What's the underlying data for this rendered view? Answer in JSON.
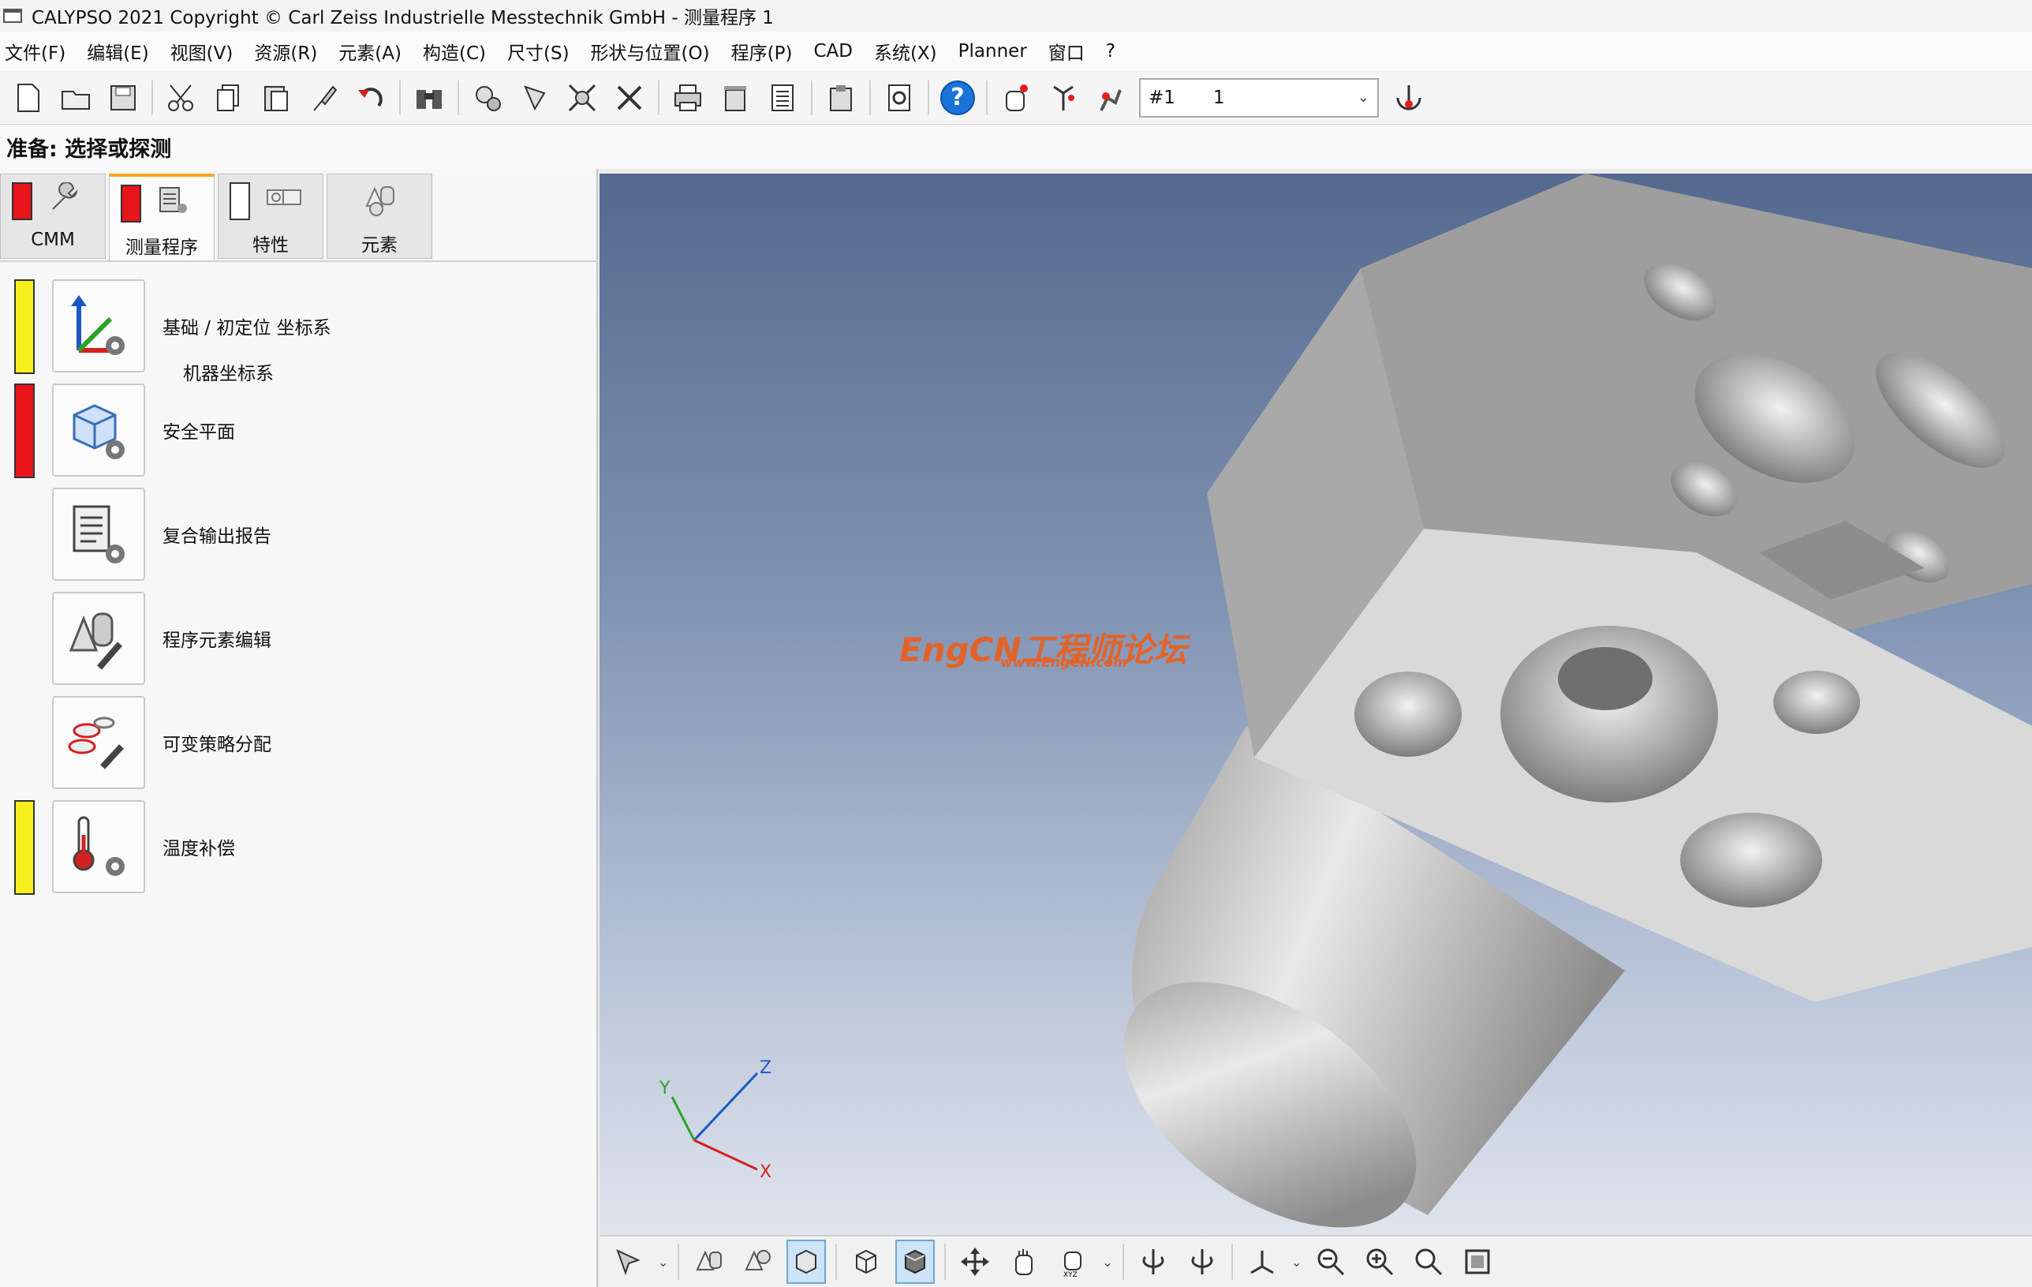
{
  "window": {
    "title": "CALYPSO 2021 Copyright © Carl Zeiss Industrielle Messtechnik GmbH - 测量程序 1"
  },
  "menu": [
    {
      "label": "文件(F)"
    },
    {
      "label": "编辑(E)"
    },
    {
      "label": "视图(V)"
    },
    {
      "label": "资源(R)"
    },
    {
      "label": "元素(A)"
    },
    {
      "label": "构造(C)"
    },
    {
      "label": "尺寸(S)"
    },
    {
      "label": "形状与位置(O)"
    },
    {
      "label": "程序(P)"
    },
    {
      "label": "CAD"
    },
    {
      "label": "系统(X)"
    },
    {
      "label": "Planner"
    },
    {
      "label": "窗口"
    },
    {
      "label": "?"
    }
  ],
  "toolbar": {
    "icons": [
      "new-file-icon",
      "open-folder-icon",
      "save-icon",
      "cut-icon",
      "copy-icon",
      "paste-icon",
      "brush-icon",
      "undo-icon",
      "binoculars-icon",
      "feature-add-icon",
      "probe-icon",
      "grid-icon",
      "tools-icon",
      "print-icon",
      "delete-icon",
      "list-icon",
      "clipboard-icon",
      "report-icon",
      "help-icon",
      "hand-icon",
      "tree-icon",
      "robot-icon"
    ],
    "combo_id": "#1",
    "combo_value": "1"
  },
  "status": {
    "text": "准备: 选择或探测"
  },
  "tabs": [
    {
      "label": "CMM",
      "flag_color": "#e8151b"
    },
    {
      "label": "测量程序",
      "flag_color": "#e8151b"
    },
    {
      "label": "特性",
      "flag_color": "#ffffff"
    },
    {
      "label": "元素",
      "flag_color": ""
    }
  ],
  "functions": [
    {
      "label": "基础 / 初定位 坐标系",
      "sub": "机器坐标系",
      "flag_color": "#f6ee1e",
      "icon": "coordinate-system-icon"
    },
    {
      "label": "安全平面",
      "sub": "",
      "flag_color": "#e8151b",
      "icon": "safety-plane-icon"
    },
    {
      "label": "复合输出报告",
      "sub": "",
      "flag_color": "",
      "icon": "report-output-icon"
    },
    {
      "label": "程序元素编辑",
      "sub": "",
      "flag_color": "",
      "icon": "element-edit-icon"
    },
    {
      "label": "可变策略分配",
      "sub": "",
      "flag_color": "",
      "icon": "strategy-icon"
    },
    {
      "label": "温度补偿",
      "sub": "",
      "flag_color": "#f6ee1e",
      "icon": "thermometer-icon"
    }
  ],
  "viewport": {
    "watermark": "EngCN工程师论坛",
    "watermark_url": "www.EngCN.com",
    "axes": {
      "x": "X",
      "y": "Y",
      "z": "Z"
    }
  },
  "bottom_toolbar": {
    "icons": [
      "select-icon",
      "feature-view-icon",
      "feature-set-icon",
      "solid-view-icon",
      "wireframe-icon",
      "shaded-icon",
      "move-icon",
      "pan-hand-icon",
      "rotate-hand-icon",
      "rotate-left-icon",
      "rotate-right-icon",
      "axis-icon",
      "zoom-out-icon",
      "zoom-in-icon",
      "zoom-icon",
      "fit-icon"
    ]
  }
}
